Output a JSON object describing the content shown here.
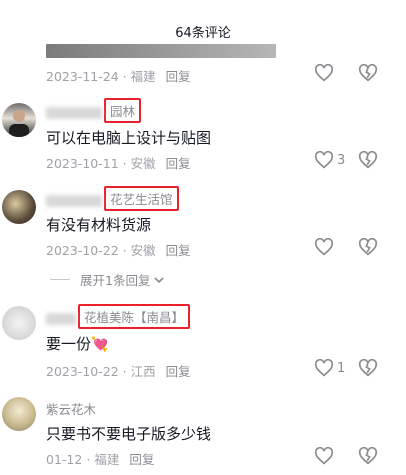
{
  "header": {
    "title": "64条评论"
  },
  "comments": [
    {
      "username": "",
      "tag": "",
      "text": "",
      "date": "2023-11-24",
      "location": "福建",
      "reply": "回复",
      "likes": ""
    },
    {
      "username": "",
      "tag": "园林",
      "text": "可以在电脑上设计与贴图",
      "date": "2023-10-11",
      "location": "安徽",
      "reply": "回复",
      "likes": "3"
    },
    {
      "username": "",
      "tag": "花艺生活馆",
      "text": "有没有材料货源",
      "date": "2023-10-22",
      "location": "安徽",
      "reply": "回复",
      "likes": ""
    },
    {
      "username": "",
      "tag": "花植美陈【南昌】",
      "text": "要一份",
      "emoji": "💘",
      "date": "2023-10-22",
      "location": "江西",
      "reply": "回复",
      "likes": "1"
    },
    {
      "username": "紫云花木",
      "tag": "",
      "text": "只要书不要电子版多少钱",
      "date": "01-12",
      "location": "福建",
      "reply": "回复",
      "likes": ""
    }
  ],
  "expand_replies": "展开1条回复",
  "icons": {
    "like": "heart-outline-icon",
    "dislike": "broken-heart-icon",
    "expand": "chevron-down-icon"
  },
  "colors": {
    "highlight_box": "#e8212a",
    "meta": "#a0a1a7",
    "text": "#161823"
  }
}
